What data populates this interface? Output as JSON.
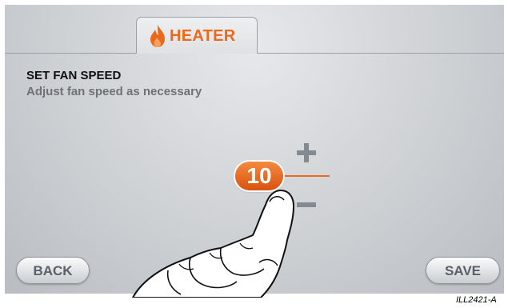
{
  "tab": {
    "label": "HEATER",
    "icon": "flame-icon",
    "icon_color": "#ea6a1d"
  },
  "header": {
    "title": "SET FAN SPEED",
    "subtitle": "Adjust fan speed as necessary"
  },
  "fan_speed": {
    "value": "10",
    "increase_icon": "plus-icon",
    "decrease_icon": "minus-icon",
    "accent": "#ec6a1f"
  },
  "buttons": {
    "back_label": "BACK",
    "save_label": "SAVE"
  },
  "illustration_id": "ILL2421-A"
}
